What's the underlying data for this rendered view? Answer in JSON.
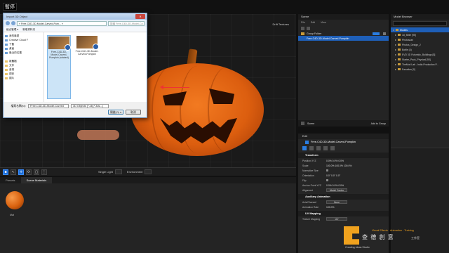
{
  "pause": "暫停",
  "viewport": {
    "label": "Drift Textures"
  },
  "dialog": {
    "title": "Import 3D Object",
    "close": "✕",
    "path": "« Free-C4D-3D-Model-Carved-Pum... »",
    "search": "搜尋 Free-C4D-3D-Model-Ca...",
    "toolbar": [
      "組合管理 ▾",
      "新增資料夾"
    ],
    "tree": [
      {
        "label": "我的最愛",
        "icon": "blue"
      },
      {
        "label": "Creative Cloud F",
        "icon": "blue"
      },
      {
        "label": "下載",
        "icon": "blue"
      },
      {
        "label": "桌面",
        "icon": "blue"
      },
      {
        "label": "最近的位置",
        "icon": "blue"
      },
      {
        "label": "",
        "icon": ""
      },
      {
        "label": "媒體櫃",
        "icon": "yellow"
      },
      {
        "label": "文件",
        "icon": "yellow"
      },
      {
        "label": "音樂",
        "icon": "yellow"
      },
      {
        "label": "視訊",
        "icon": "yellow"
      },
      {
        "label": "圖片",
        "icon": "yellow"
      }
    ],
    "files": [
      {
        "name": "Free-C4D-3D-Model-Carved-Pumpkin (rotated)",
        "selected": true
      },
      {
        "name": "Free-C4D-3D-Model-Carved-Pumpkin",
        "selected": false
      }
    ],
    "filename_label": "檔案名稱(N):",
    "filename_value": "Free-C4D-3D-Model-Carved",
    "filetype_value": "3D Objects (*.obj;*.3ds...)",
    "open_button": "開啟(O) ▾",
    "cancel_button": "取消"
  },
  "vp_toolbar": {
    "light_label": "Single Light",
    "env_label": "Environment"
  },
  "bottom_panel": {
    "tabs": [
      "Presets",
      "Scene Materials"
    ],
    "material_label": "Mat"
  },
  "scene": {
    "title": "Scene",
    "menu": [
      "File",
      "Edit",
      "View"
    ],
    "rows": [
      {
        "label": "Group Folder",
        "selected": false
      },
      {
        "label": "Free-C4D-3D-Model-Carved-Pumpkin",
        "selected": true
      }
    ],
    "foot_left": "Scene",
    "foot_right": "Add to Group"
  },
  "settings": {
    "title": "Edit",
    "object": "Free-C4D-3D-Model-Carved-Pumpkin",
    "sections": [
      {
        "name": "Transform",
        "props": [
          {
            "k": "Position XYZ",
            "v": "0.0%  0.0%  0.0%"
          },
          {
            "k": "Scale",
            "v": "100.0%  100.0%  100.0%"
          },
          {
            "k": "Normalize Size",
            "v": ""
          },
          {
            "k": "Orientation",
            "v": "0.0°  0.0°  0.0°"
          },
          {
            "k": "Flip",
            "v": ""
          },
          {
            "k": "Anchor Point XYZ",
            "v": "0.0%  0.0%  0.0%"
          },
          {
            "k": "Alignment",
            "v": "Model Center"
          }
        ]
      },
      {
        "name": "Auxiliary Animation",
        "props": [
          {
            "k": "Axis/Channel",
            "v": "None"
          },
          {
            "k": "Animation Rate",
            "v": "100.0%"
          }
        ]
      },
      {
        "name": "UV Mapping",
        "props": [
          {
            "k": "Texture Mapping",
            "v": "UV"
          }
        ]
      }
    ]
  },
  "browser": {
    "title": "Model Browser",
    "items": [
      {
        "label": "Models",
        "selected": true
      },
      {
        "label": "3d_Bible [95]",
        "selected": false
      },
      {
        "label": "Photoscan",
        "selected": false
      },
      {
        "label": "Photos_Design_2",
        "selected": false
      },
      {
        "label": "Bottle (4)",
        "selected": false
      },
      {
        "label": "EVD 3D Futuristic_Buildings [8]",
        "selected": false
      },
      {
        "label": "Starter_Pack_Physical [50]",
        "selected": false
      },
      {
        "label": "TheMod Lab - India Production P...",
        "selected": false
      },
      {
        "label": "Favorites [0]",
        "selected": false
      }
    ]
  },
  "watermark": {
    "tagline": "Visual Effects · Animation · Training",
    "chinese": "查 德 創 意",
    "small": "工作室",
    "sub": "Creating Ideas Studio"
  },
  "colors": {
    "accent": "#1e6fd9",
    "pumpkin": "#e06412",
    "logo": "#f0a21e"
  }
}
